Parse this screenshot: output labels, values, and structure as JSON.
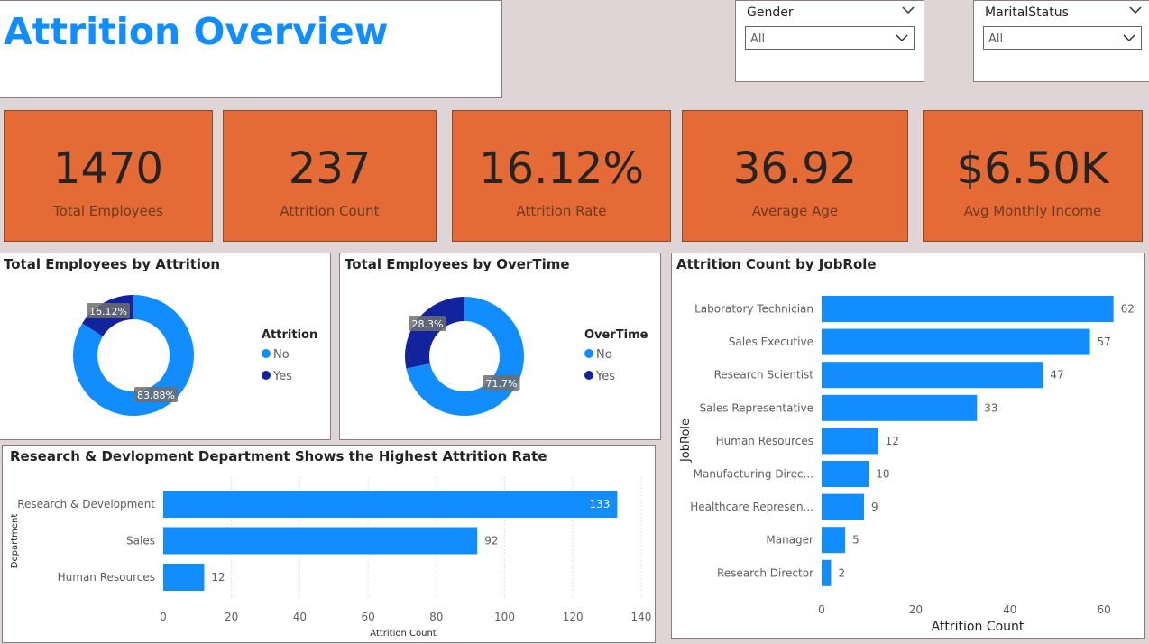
{
  "header": {
    "title": "Attrition Overview"
  },
  "filters": {
    "gender": {
      "label": "Gender",
      "value": "All"
    },
    "marital": {
      "label": "MaritalStatus",
      "value": "All"
    }
  },
  "kpis": [
    {
      "value": "1470",
      "label": "Total Employees"
    },
    {
      "value": "237",
      "label": "Attrition Count"
    },
    {
      "value": "16.12%",
      "label": "Attrition Rate"
    },
    {
      "value": "36.92",
      "label": "Average Age"
    },
    {
      "value": "$6.50K",
      "label": "Avg Monthly Income"
    }
  ],
  "colors": {
    "accent": "#118dff",
    "dark_blue": "#12239e",
    "kpi_bg": "#e46b35",
    "page_bg": "#dfd5d6"
  },
  "chart_data": [
    {
      "type": "pie",
      "title": "Total Employees by Attrition",
      "legend_title": "Attrition",
      "legend_placement": "right",
      "slices": [
        {
          "name": "No",
          "value": 83.88,
          "label": "83.88%",
          "color": "#118dff"
        },
        {
          "name": "Yes",
          "value": 16.12,
          "label": "16.12%",
          "color": "#12239e"
        }
      ]
    },
    {
      "type": "pie",
      "title": "Total Employees by OverTime",
      "legend_title": "OverTime",
      "legend_placement": "right",
      "slices": [
        {
          "name": "No",
          "value": 71.7,
          "label": "71.7%",
          "color": "#118dff"
        },
        {
          "name": "Yes",
          "value": 28.3,
          "label": "28.3%",
          "color": "#12239e"
        }
      ]
    },
    {
      "type": "bar",
      "orientation": "horizontal",
      "title": "Attrition Count by JobRole",
      "xlabel": "Attrition Count",
      "ylabel": "JobRole",
      "xlim": [
        0,
        62
      ],
      "xticks": [
        0,
        20,
        40,
        60
      ],
      "categories": [
        "Laboratory Technician",
        "Sales Executive",
        "Research Scientist",
        "Sales Representative",
        "Human Resources",
        "Manufacturing Direc...",
        "Healthcare Represen...",
        "Manager",
        "Research Director"
      ],
      "values": [
        62,
        57,
        47,
        33,
        12,
        10,
        9,
        5,
        2
      ],
      "grid": false
    },
    {
      "type": "bar",
      "orientation": "horizontal",
      "title": "Research & Devlopment Department Shows the Highest Attrition Rate",
      "xlabel": "Attrition Count",
      "ylabel": "Department",
      "xlim": [
        0,
        140
      ],
      "xticks": [
        0,
        20,
        40,
        60,
        80,
        100,
        120,
        140
      ],
      "categories": [
        "Research & Development",
        "Sales",
        "Human Resources"
      ],
      "values": [
        133,
        92,
        12
      ],
      "grid": true
    }
  ]
}
